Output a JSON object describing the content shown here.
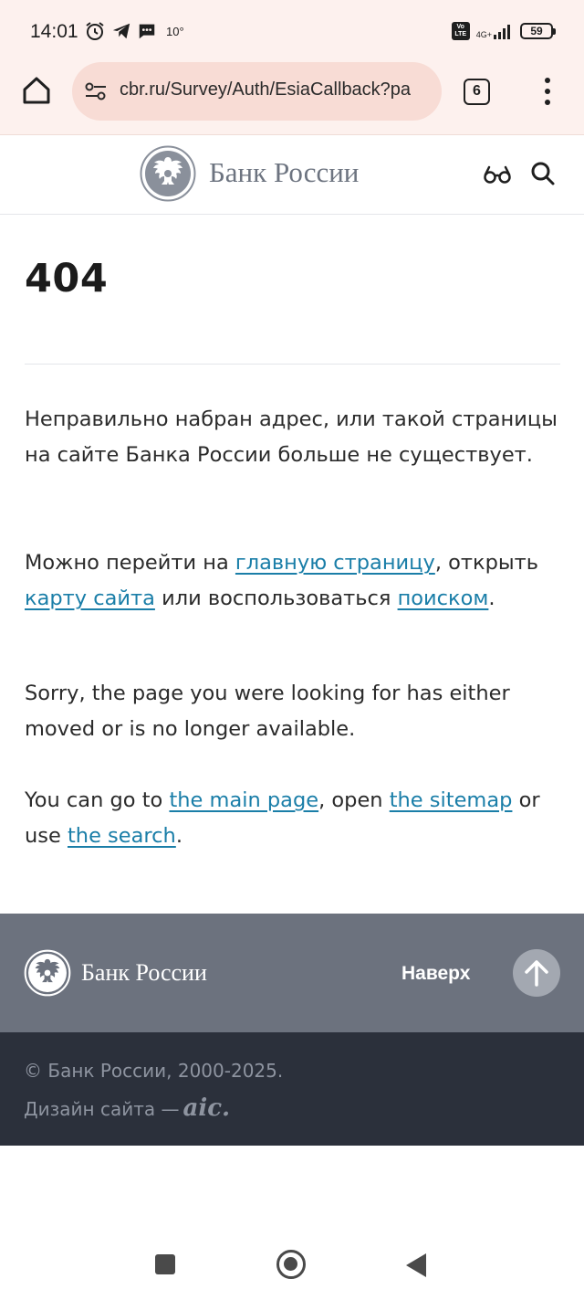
{
  "status_bar": {
    "time": "14:01",
    "temperature": "10°",
    "net_type": "4G+",
    "volte": "Vo LTE",
    "battery": "59",
    "icons": [
      "alarm-icon",
      "telegram-icon",
      "message-icon",
      "signal-icon",
      "battery-icon"
    ]
  },
  "browser": {
    "url": "cbr.ru/Survey/Auth/EsiaCallback?pa",
    "tab_count": "6",
    "icons": [
      "home-icon",
      "site-settings-icon",
      "tabs-icon",
      "more-menu-icon"
    ]
  },
  "header": {
    "site_title": "Банк России",
    "icons": [
      "bank-emblem-icon",
      "accessibility-glasses-icon",
      "search-icon"
    ]
  },
  "main": {
    "error_code": "404",
    "ru_message": "Неправильно набран адрес, или такой страницы на сайте Банка России больше не существует.",
    "ru_nav": {
      "before": "Можно перейти на ",
      "link_main": "главную страницу",
      "middle1": ", открыть ",
      "link_sitemap": "карту сайта",
      "middle2": " или воспользоваться ",
      "link_search": "поиском",
      "after": "."
    },
    "en_message": "Sorry, the page you were looking for has either moved or is no longer available.",
    "en_nav": {
      "before": "You can go to ",
      "link_main": "the main page",
      "middle1": ", open ",
      "link_sitemap": "the sitemap",
      "middle2": " or use ",
      "link_search": "the search",
      "after": "."
    }
  },
  "footer": {
    "site_title": "Банк России",
    "up_label": "Наверх",
    "copyright": "© Банк России, 2000-2025.",
    "design_label": "Дизайн сайта —",
    "design_brand": "aic.",
    "icons": [
      "bank-emblem-icon",
      "arrow-up-icon"
    ]
  },
  "colors": {
    "chrome_bg": "#fdf1ee",
    "url_pill": "#f8dcd5",
    "link": "#1a7ea8",
    "footer_top": "#6c727e",
    "footer_bottom": "#2b303b"
  }
}
